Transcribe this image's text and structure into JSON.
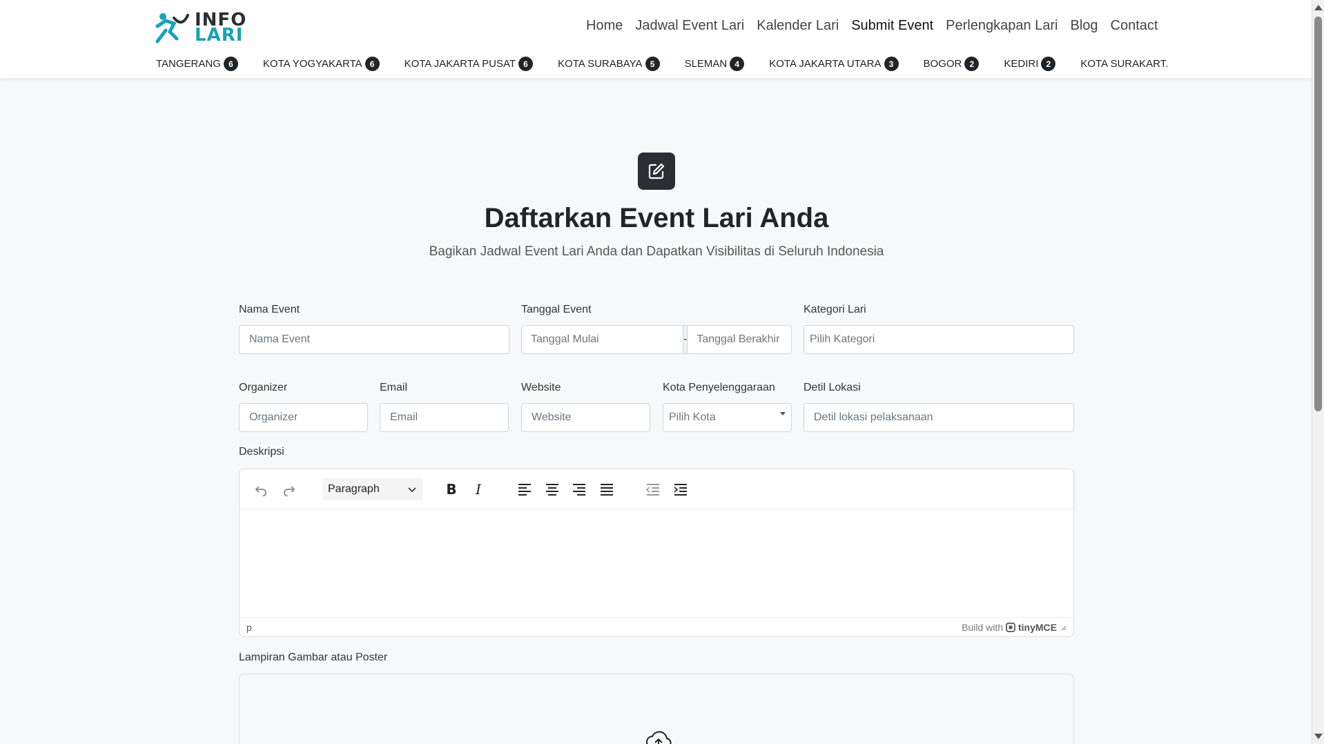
{
  "brand": {
    "line1": "INFO",
    "line2": "LARI"
  },
  "nav": [
    {
      "label": "Home"
    },
    {
      "label": "Jadwal Event Lari"
    },
    {
      "label": "Kalender Lari"
    },
    {
      "label": "Submit Event",
      "active": true
    },
    {
      "label": "Perlengkapan Lari"
    },
    {
      "label": "Blog"
    },
    {
      "label": "Contact"
    }
  ],
  "cities": [
    {
      "name": "TANGERANG",
      "count": "6"
    },
    {
      "name": "KOTA YOGYAKARTA",
      "count": "6"
    },
    {
      "name": "KOTA JAKARTA PUSAT",
      "count": "6"
    },
    {
      "name": "KOTA SURABAYA",
      "count": "5"
    },
    {
      "name": "SLEMAN",
      "count": "4"
    },
    {
      "name": "KOTA JAKARTA UTARA",
      "count": "3"
    },
    {
      "name": "BOGOR",
      "count": "2"
    },
    {
      "name": "KEDIRI",
      "count": "2"
    },
    {
      "name": "KOTA SURAKART.",
      "count": ""
    }
  ],
  "page": {
    "title": "Daftarkan Event Lari Anda",
    "subtitle": "Bagikan Jadwal Event Lari Anda dan Dapatkan Visibilitas di Seluruh Indonesia"
  },
  "form": {
    "nama_event": {
      "label": "Nama Event",
      "placeholder": "Nama Event"
    },
    "tanggal": {
      "label": "Tanggal Event",
      "start_placeholder": "Tanggal Mulai",
      "separator": "-",
      "end_placeholder": "Tanggal Berakhir"
    },
    "kategori": {
      "label": "Kategori Lari",
      "placeholder": "Pilih Kategori"
    },
    "organizer": {
      "label": "Organizer",
      "placeholder": "Organizer"
    },
    "email": {
      "label": "Email",
      "placeholder": "Email"
    },
    "website": {
      "label": "Website",
      "placeholder": "Website"
    },
    "kota": {
      "label": "Kota Penyelenggaraan",
      "placeholder": "Pilih Kota"
    },
    "lokasi": {
      "label": "Detil Lokasi",
      "placeholder": "Detil lokasi pelaksanaan"
    },
    "deskripsi": {
      "label": "Deskripsi",
      "block_format": "Paragraph",
      "path": "p",
      "build_with": "Build with",
      "brand": "tinyMCE"
    },
    "lampiran": {
      "label": "Lampiran Gambar atau Poster"
    }
  },
  "icons": {
    "hero": "edit-square-icon",
    "upload": "cloud-upload-icon"
  }
}
